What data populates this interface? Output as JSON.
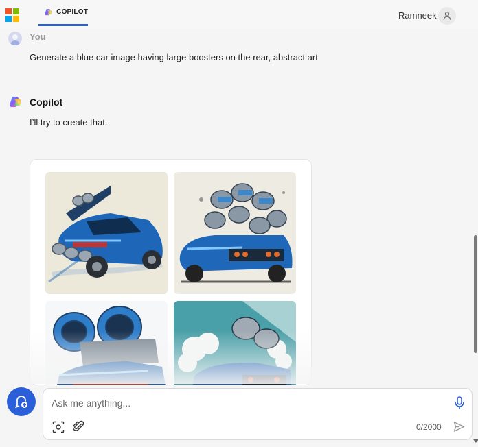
{
  "header": {
    "tab_label": "COPILOT",
    "user_name": "Ramneek"
  },
  "conversation": {
    "user_author": "You",
    "user_message": "Generate a blue car image having large boosters on the rear, abstract art",
    "bot_author": "Copilot",
    "bot_message": "I’ll try to create that."
  },
  "composer": {
    "placeholder": "Ask me anything...",
    "char_count": "0/2000"
  },
  "colors": {
    "accent": "#2b5fd9",
    "tab_underline": "#2f62c8"
  },
  "icons": {
    "brand": "microsoft-logo-icon",
    "copilot": "copilot-logo-icon",
    "user": "user-icon",
    "new_topic": "new-topic-icon",
    "mic": "microphone-icon",
    "camera": "visual-search-icon",
    "attach": "paperclip-icon",
    "send": "send-icon"
  }
}
